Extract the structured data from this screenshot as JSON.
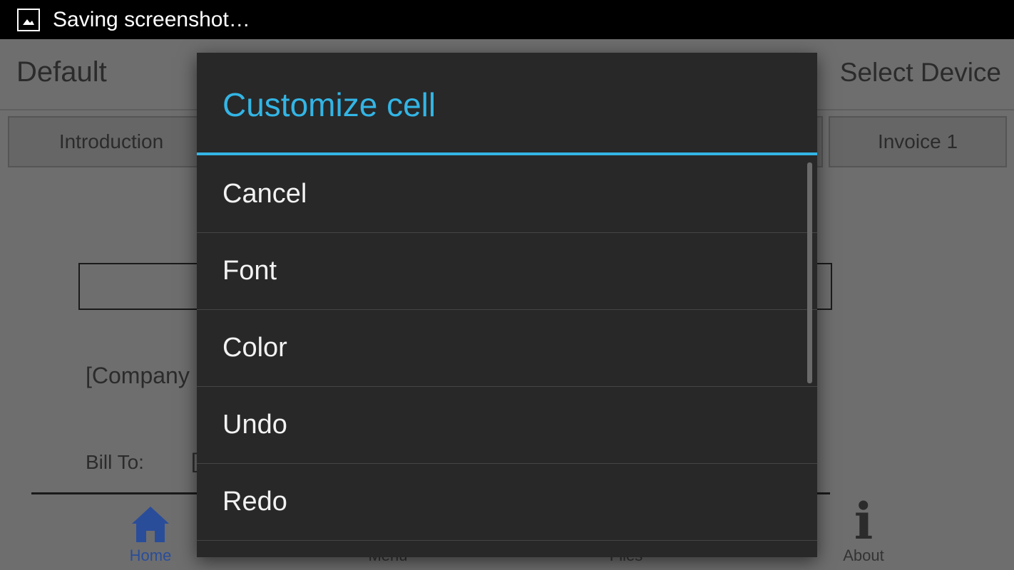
{
  "status_bar": {
    "text": "Saving screenshot…",
    "icon": "image-icon"
  },
  "app_bar": {
    "title": "Default",
    "action": "Select Device"
  },
  "tabs": {
    "first": "Introduction",
    "last": "Invoice 1"
  },
  "document": {
    "company": "[Company",
    "bill_to": "Bill To:",
    "bracket": "["
  },
  "bottom_nav": {
    "items": [
      {
        "label": "Home",
        "icon": "home-icon",
        "color": "#2a4d9a"
      },
      {
        "label": "Menu",
        "icon": "menu-icon"
      },
      {
        "label": "Files",
        "icon": "files-icon"
      },
      {
        "label": "About",
        "icon": "info-icon"
      }
    ]
  },
  "dialog": {
    "title": "Customize cell",
    "accent": "#33b5e5",
    "items": [
      "Cancel",
      "Font",
      "Color",
      "Undo",
      "Redo"
    ]
  }
}
